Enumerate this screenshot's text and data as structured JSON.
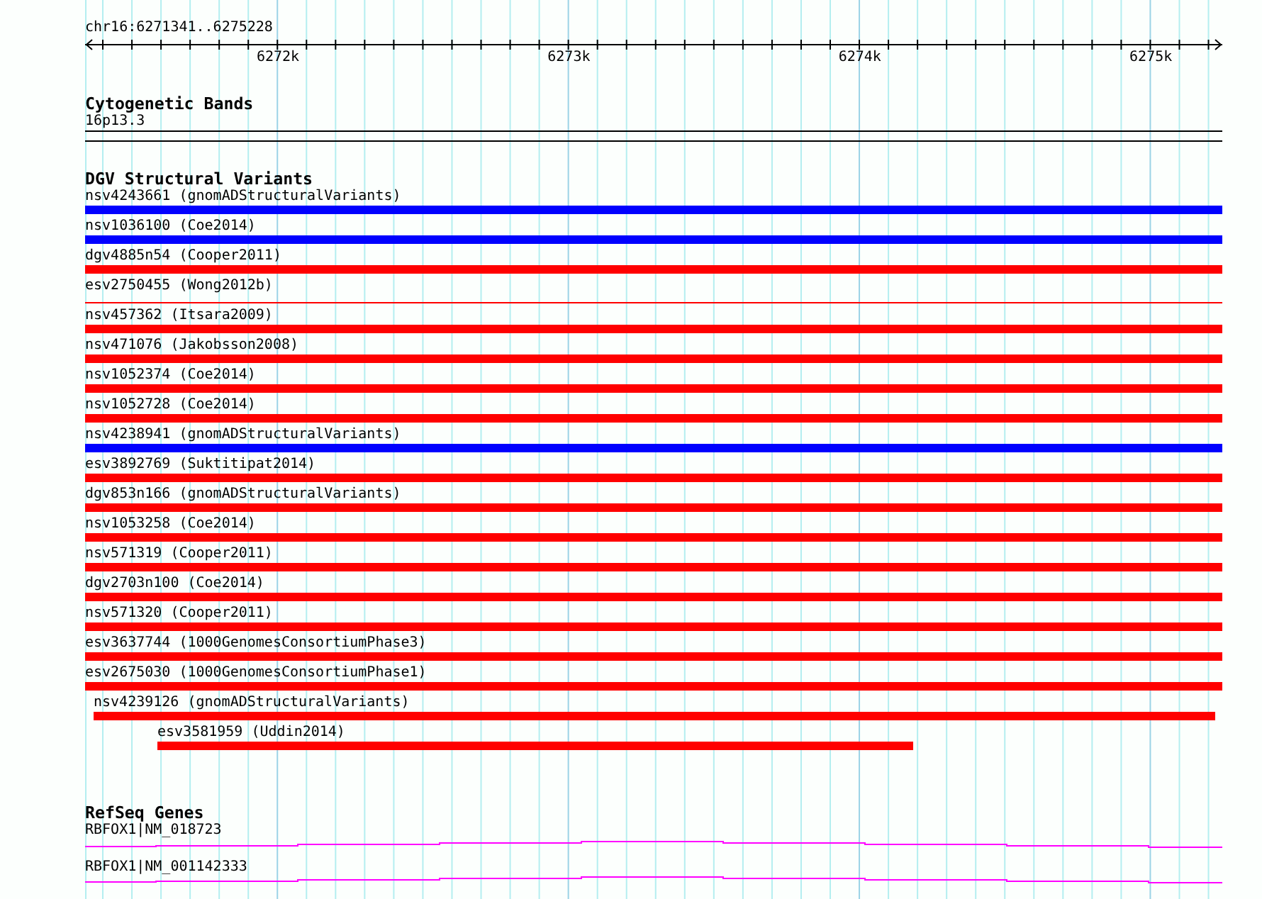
{
  "ruler": {
    "location": "chr16:6271341..6275228",
    "ticks": [
      "6272k",
      "6273k",
      "6274k",
      "6275k"
    ]
  },
  "cytogenetic_bands": {
    "title": "Cytogenetic Bands",
    "band": "16p13.3"
  },
  "dgv": {
    "title": "DGV Structural Variants",
    "variants": [
      {
        "label": "nsv4243661 (gnomADStructuralVariants)",
        "color": "#0000ff",
        "kind": "bar"
      },
      {
        "label": "nsv1036100 (Coe2014)",
        "color": "#0000ff",
        "kind": "bar"
      },
      {
        "label": "dgv4885n54 (Cooper2011)",
        "color": "#ff0000",
        "kind": "bar"
      },
      {
        "label": "esv2750455 (Wong2012b)",
        "color": "#ff0000",
        "kind": "line"
      },
      {
        "label": "nsv457362 (Itsara2009)",
        "color": "#ff0000",
        "kind": "bar"
      },
      {
        "label": "nsv471076 (Jakobsson2008)",
        "color": "#ff0000",
        "kind": "bar"
      },
      {
        "label": "nsv1052374 (Coe2014)",
        "color": "#ff0000",
        "kind": "bar"
      },
      {
        "label": "nsv1052728 (Coe2014)",
        "color": "#ff0000",
        "kind": "bar"
      },
      {
        "label": "nsv4238941 (gnomADStructuralVariants)",
        "color": "#0000ff",
        "kind": "bar"
      },
      {
        "label": "esv3892769 (Suktitipat2014)",
        "color": "#ff0000",
        "kind": "bar"
      },
      {
        "label": "dgv853n166 (gnomADStructuralVariants)",
        "color": "#ff0000",
        "kind": "bar"
      },
      {
        "label": "nsv1053258 (Coe2014)",
        "color": "#ff0000",
        "kind": "bar"
      },
      {
        "label": "nsv571319 (Cooper2011)",
        "color": "#ff0000",
        "kind": "bar"
      },
      {
        "label": "dgv2703n100 (Coe2014)",
        "color": "#ff0000",
        "kind": "bar"
      },
      {
        "label": "nsv571320 (Cooper2011)",
        "color": "#ff0000",
        "kind": "bar"
      },
      {
        "label": "esv3637744 (1000GenomesConsortiumPhase3)",
        "color": "#ff0000",
        "kind": "bar"
      },
      {
        "label": "esv2675030 (1000GenomesConsortiumPhase1)",
        "color": "#ff0000",
        "kind": "bar"
      },
      {
        "label": "nsv4239126 (gnomADStructuralVariants)",
        "color": "#ff0000",
        "kind": "bar"
      },
      {
        "label": "esv3581959 (Uddin2014)",
        "color": "#ff0000",
        "kind": "bar"
      }
    ]
  },
  "refseq": {
    "title": "RefSeq Genes",
    "genes": [
      {
        "label": "RBFOX1|NM_018723"
      },
      {
        "label": "RBFOX1|NM_001142333"
      }
    ]
  }
}
